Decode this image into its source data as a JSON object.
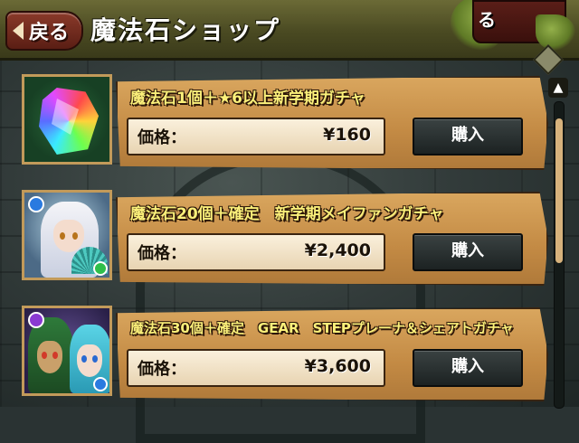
{
  "header": {
    "back_label": "戻る",
    "title": "魔法石ショップ",
    "close_label": "る"
  },
  "items": [
    {
      "title": "魔法石1個＋★6以上新学期ガチャ",
      "price_label": "価格：",
      "price": "¥160",
      "buy_label": "購入",
      "image": "rainbow-gem-icon"
    },
    {
      "title": "魔法石20個＋確定　新学期メイファンガチャ",
      "price_label": "価格：",
      "price": "¥2,400",
      "buy_label": "購入",
      "image": "meifang-character-icon"
    },
    {
      "title": "魔法石30個＋確定　GEAR　STEPプレーナ＆シェアトガチャ",
      "price_label": "価格：",
      "price": "¥3,600",
      "buy_label": "購入",
      "image": "plena-sheat-character-icon"
    }
  ],
  "scrollbar": {
    "up_arrow": "▲",
    "position": 0.1
  },
  "colors": {
    "title_text": "#fbf07a",
    "panel": "#c38a44",
    "buy_button": "#2a3232",
    "back_button": "#7a2e20"
  }
}
